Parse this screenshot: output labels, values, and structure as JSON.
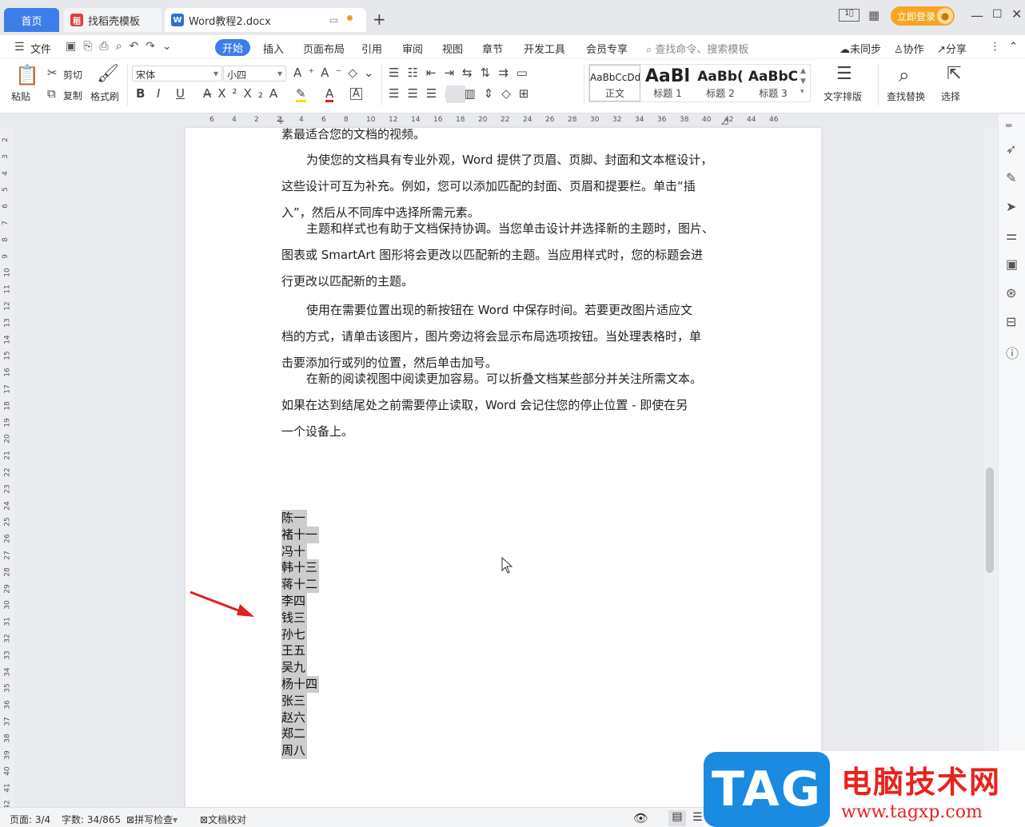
{
  "tabs": {
    "home": "首页",
    "template": "找稻壳模板",
    "doc": "Word教程2.docx",
    "add": "+"
  },
  "window": {
    "login": "立即登录"
  },
  "menu": {
    "file": "文件",
    "items": [
      "开始",
      "插入",
      "页面布局",
      "引用",
      "审阅",
      "视图",
      "章节",
      "开发工具",
      "会员专享"
    ],
    "search": "查找命令、搜索模板",
    "unsynced": "未同步",
    "collab": "协作",
    "share": "分享"
  },
  "ribbon": {
    "paste": "粘贴",
    "cut": "剪切",
    "copy": "复制",
    "format_painter": "格式刷",
    "font": "宋体",
    "size": "小四",
    "styles": [
      {
        "preview": "AaBbCcDd",
        "label": "正文"
      },
      {
        "preview": "AaBl",
        "label": "标题 1"
      },
      {
        "preview": "AaBb(",
        "label": "标题 2"
      },
      {
        "preview": "AaBbC",
        "label": "标题 3"
      }
    ],
    "text_layout": "文字排版",
    "find_replace": "查找替换",
    "select": "选择"
  },
  "ruler": {
    "h": [
      "6",
      "4",
      "2",
      "2",
      "4",
      "6",
      "8",
      "10",
      "12",
      "14",
      "16",
      "18",
      "20",
      "22",
      "24",
      "26",
      "28",
      "30",
      "32",
      "34",
      "36",
      "38",
      "40",
      "42",
      "44",
      "46"
    ],
    "v": [
      "2",
      "3",
      "4",
      "5",
      "6",
      "7",
      "8",
      "9",
      "10",
      "11",
      "12",
      "13",
      "14",
      "15",
      "16",
      "17",
      "18",
      "19",
      "20",
      "21",
      "22",
      "23",
      "24",
      "25",
      "26",
      "27",
      "28",
      "29",
      "30",
      "31",
      "32",
      "33",
      "34",
      "35",
      "36",
      "37",
      "38",
      "39",
      "40",
      "41",
      "42"
    ]
  },
  "document": {
    "top_partial": "素最适合您的文档的视频。",
    "paragraphs": [
      [
        "为使您的文档具有专业外观，Word 提供了页眉、页脚、封面和文本框设计，",
        "这些设计可互为补充。例如，您可以添加匹配的封面、页眉和提要栏。单击“插",
        "入”，然后从不同库中选择所需元素。"
      ],
      [
        "主题和样式也有助于文档保持协调。当您单击设计并选择新的主题时，图片、",
        "图表或 SmartArt 图形将会更改以匹配新的主题。当应用样式时，您的标题会进",
        "行更改以匹配新的主题。"
      ],
      [
        "使用在需要位置出现的新按钮在 Word 中保存时间。若要更改图片适应文",
        "档的方式，请单击该图片，图片旁边将会显示布局选项按钮。当处理表格时，单",
        "击要添加行或列的位置，然后单击加号。"
      ],
      [
        "在新的阅读视图中阅读更加容易。可以折叠文档某些部分并关注所需文本。",
        "如果在达到结尾处之前需要停止读取，Word 会记住您的停止位置 - 即使在另",
        "一个设备上。"
      ]
    ],
    "names": [
      "陈一",
      "褚十一",
      "冯十",
      "韩十三",
      "蒋十二",
      "李四",
      "钱三",
      "孙七",
      "王五",
      "吴九",
      "杨十四",
      "张三",
      "赵六",
      "郑二",
      "周八"
    ]
  },
  "status": {
    "page": "页面: 3/4",
    "words": "字数: 34/865",
    "spell": "拼写检查",
    "proof": "文档校对"
  },
  "watermark": {
    "logo": "TAG",
    "title": "电脑技术网",
    "url": "www.tagxp.com"
  },
  "colors": {
    "accent": "#3d7de8",
    "selection": "#cdcdcd",
    "arrow": "#e02020",
    "login": "#f5a623",
    "watermark_red": "#e8221c",
    "watermark_blue": "#1a8be0"
  }
}
